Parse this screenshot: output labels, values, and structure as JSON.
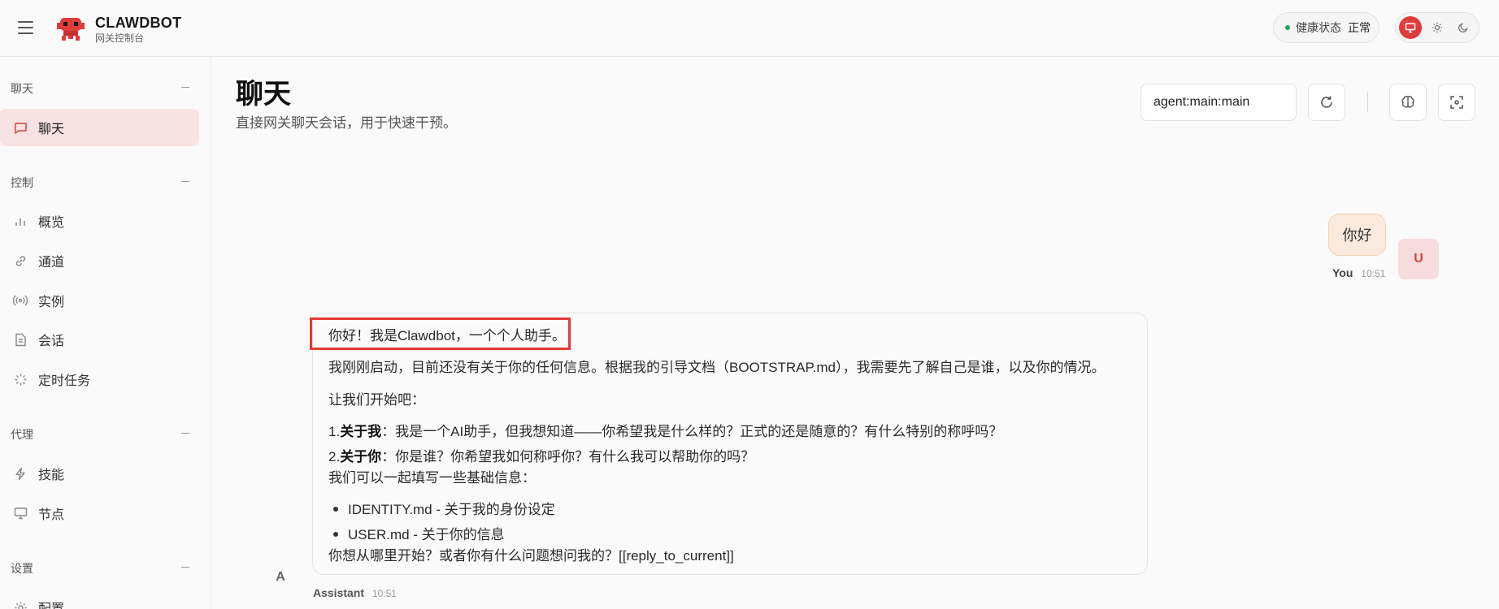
{
  "brand": {
    "name": "CLAWDBOT",
    "subtitle": "网关控制台"
  },
  "health": {
    "label": "健康状态",
    "value": "正常",
    "color": "#22a35a"
  },
  "theme": {
    "active": "system",
    "options": [
      "monitor-icon",
      "sun-icon",
      "moon-icon"
    ],
    "accent": "#e23b3b"
  },
  "sidebar": {
    "groups": [
      {
        "label": "聊天",
        "items": [
          {
            "label": "聊天",
            "icon": "chat-icon",
            "active": true
          }
        ]
      },
      {
        "label": "控制",
        "items": [
          {
            "label": "概览",
            "icon": "bar-chart-icon"
          },
          {
            "label": "通道",
            "icon": "link-icon"
          },
          {
            "label": "实例",
            "icon": "broadcast-icon"
          },
          {
            "label": "会话",
            "icon": "document-icon"
          },
          {
            "label": "定时任务",
            "icon": "loader-icon"
          }
        ]
      },
      {
        "label": "代理",
        "items": [
          {
            "label": "技能",
            "icon": "lightning-icon"
          },
          {
            "label": "节点",
            "icon": "monitor-icon"
          }
        ]
      },
      {
        "label": "设置",
        "items": [
          {
            "label": "配置",
            "icon": "gear-icon"
          }
        ]
      }
    ]
  },
  "header": {
    "title": "聊天",
    "subtitle": "直接网关聊天会话，用于快速干预。",
    "session_value": "agent:main:main"
  },
  "messages": {
    "user": {
      "text": "你好",
      "avatar": "U",
      "sender": "You",
      "time": "10:51"
    },
    "assistant": {
      "avatar": "A",
      "sender": "Assistant",
      "time": "10:51",
      "greeting": "你好！我是Clawdbot，一个个人助手。",
      "intro": "我刚刚启动，目前还没有关于你的任何信息。根据我的引导文档（BOOTSTRAP.md），我需要先了解自己是谁，以及你的情况。",
      "lets_start": "让我们开始吧：",
      "ol": [
        {
          "num": "1.",
          "bold": "关于我",
          "text": "：我是一个AI助手，但我想知道——你希望我是什么样的？正式的还是随意的？有什么特别的称呼吗？"
        },
        {
          "num": "2.",
          "bold": "关于你",
          "text": "：你是谁？你希望我如何称呼你？有什么我可以帮助你的吗？"
        }
      ],
      "fill_in": "我们可以一起填写一些基础信息：",
      "ul": [
        "IDENTITY.md - 关于我的身份设定",
        "USER.md - 关于你的信息"
      ],
      "closing": "你想从哪里开始？或者你有什么问题想问我的？[[reply_to_current]]"
    }
  }
}
